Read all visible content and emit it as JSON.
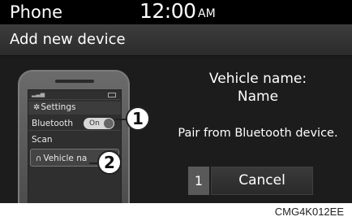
{
  "status_bar": {
    "app": "Phone",
    "time": "12:00",
    "ampm": "AM"
  },
  "title_bar": {
    "title": "Add new device"
  },
  "phone_illustration": {
    "settings_label": "Settings",
    "bluetooth_label": "Bluetooth",
    "toggle_label": "On",
    "scan_label": "Scan",
    "vehicle_label": "Vehicle na"
  },
  "callouts": [
    "1",
    "2"
  ],
  "panel": {
    "vehicle_name_label": "Vehicle name:",
    "vehicle_name_value": "Name",
    "pair_instruction": "Pair from Bluetooth device.",
    "cancel_number": "1",
    "cancel_label": "Cancel"
  },
  "caption": "CMG4K012EE"
}
